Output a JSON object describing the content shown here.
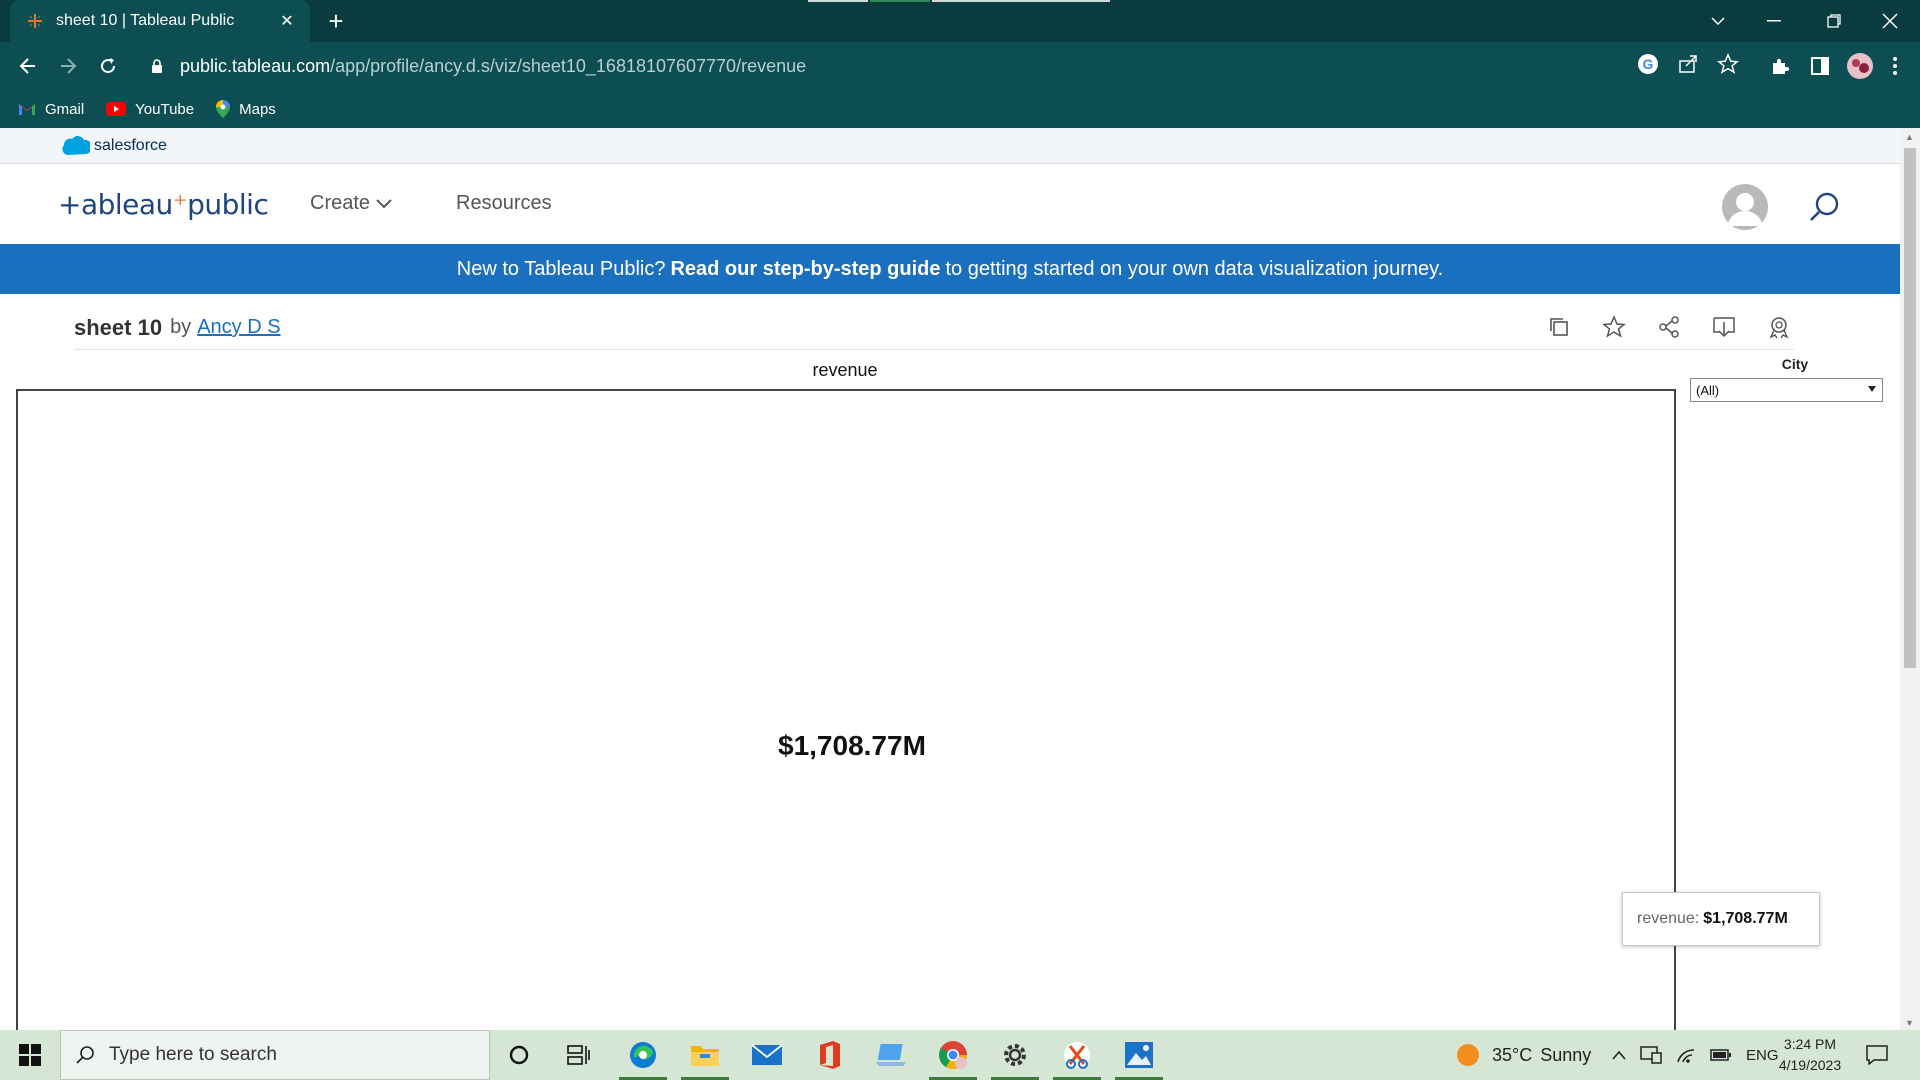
{
  "browser": {
    "tab_title": "sheet 10 | Tableau Public",
    "url_host": "public.tableau.com",
    "url_path": "/app/profile/ancy.d.s/viz/sheet10_16818107607770/revenue",
    "bookmarks": [
      {
        "label": "Gmail",
        "icon": "gmail-icon"
      },
      {
        "label": "YouTube",
        "icon": "youtube-icon"
      },
      {
        "label": "Maps",
        "icon": "maps-icon"
      }
    ]
  },
  "salesforce": {
    "label": "salesforce"
  },
  "tableau": {
    "logo": {
      "prefix": "+ableau",
      "suffix": "public"
    },
    "nav": {
      "create": "Create",
      "resources": "Resources"
    },
    "banner": {
      "before": "New to Tableau Public?",
      "link": "Read our step-by-step guide",
      "after": "to getting started on your own data visualization journey."
    },
    "viz": {
      "sheet_title": "sheet 10",
      "by": "by",
      "author": "Ancy D S",
      "worksheet_title": "revenue",
      "kpi_value": "$1,708.77M",
      "filter": {
        "title": "City",
        "selected": "(All)"
      },
      "tooltip": {
        "key": "revenue:",
        "value": "$1,708.77M"
      }
    }
  },
  "taskbar": {
    "search_placeholder": "Type here to search",
    "weather": {
      "temp": "35°C",
      "condition": "Sunny"
    },
    "language": "ENG",
    "time": "3:24 PM",
    "date": "4/19/2023"
  },
  "colors": {
    "chrome_dark": "#0a3b3f",
    "chrome_toolbar": "#0d4e52",
    "banner_blue": "#1a6fbf",
    "tableau_navy": "#1f457e",
    "taskbar": "#d6e6d4"
  }
}
